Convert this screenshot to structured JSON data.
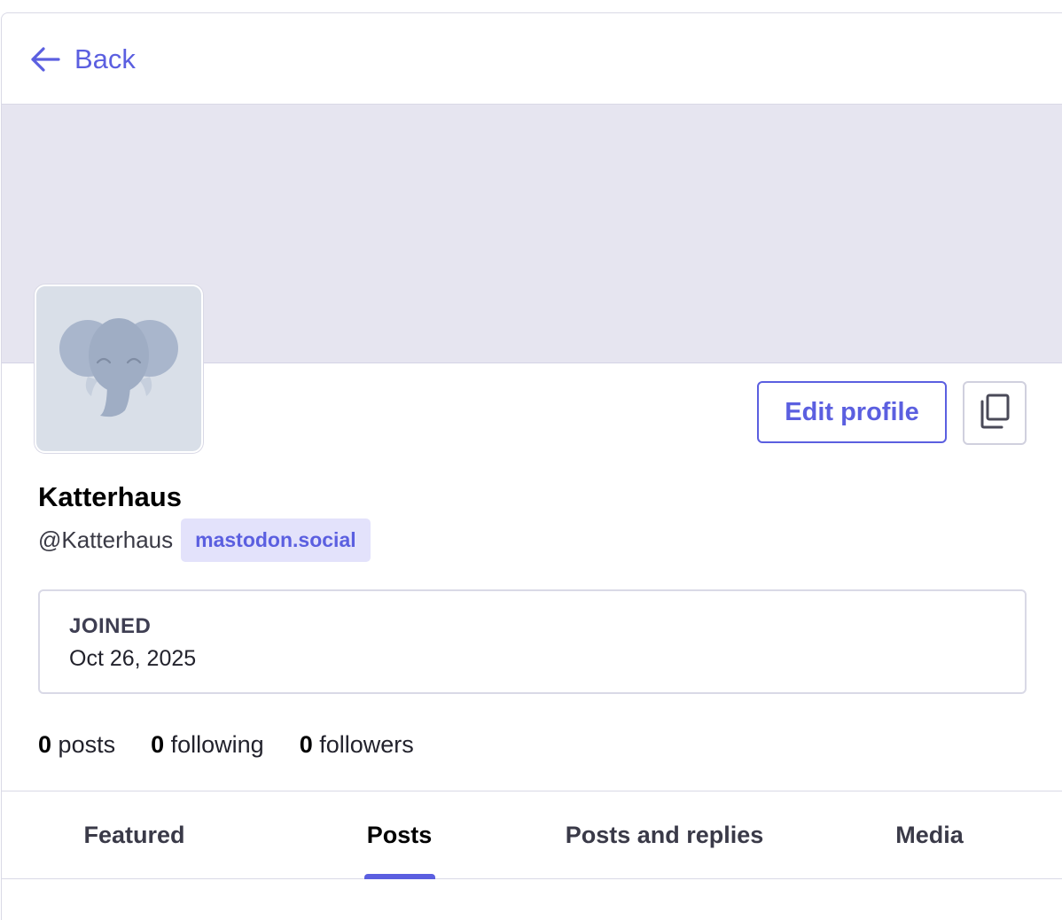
{
  "nav": {
    "back_label": "Back"
  },
  "profile": {
    "display_name": "Katterhaus",
    "acct": "@Katterhaus",
    "domain": "mastodon.social",
    "edit_label": "Edit profile"
  },
  "fields": [
    {
      "label": "JOINED",
      "value": "Oct 26, 2025"
    }
  ],
  "counts": [
    {
      "value": "0",
      "label": "posts"
    },
    {
      "value": "0",
      "label": "following"
    },
    {
      "value": "0",
      "label": "followers"
    }
  ],
  "tabs": [
    {
      "label": "Featured",
      "active": false
    },
    {
      "label": "Posts",
      "active": true
    },
    {
      "label": "Posts and replies",
      "active": false
    },
    {
      "label": "Media",
      "active": false
    }
  ],
  "colors": {
    "accent": "#5b5fe0",
    "header_bg": "#e6e5f0",
    "avatar_bg": "#d9dfe8",
    "badge_bg": "#e3e2fb"
  },
  "icons": {
    "back": "arrow-left-icon",
    "copy": "copy-icon",
    "avatar": "mastodon-elephant-icon"
  }
}
